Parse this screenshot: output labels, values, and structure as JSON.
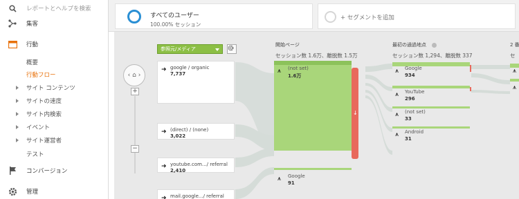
{
  "sidebar": {
    "search_placeholder": "レポートとヘルプを検索",
    "acquisition": "集客",
    "behavior": "行動",
    "behavior_items": [
      "概要",
      "行動フロー"
    ],
    "behavior_subitems": [
      "サイト コンテンツ",
      "サイトの速度",
      "サイト内検索",
      "イベント",
      "サイト運営者"
    ],
    "test": "テスト",
    "conversion": "コンバージョン",
    "admin": "管理",
    "accent": "#e8710a"
  },
  "segments": {
    "all_users": "すべてのユーザー",
    "all_users_sub": "100.00% セッション",
    "add_segment": "+ セグメントを追加"
  },
  "flow": {
    "dimension_dropdown": "参照元/メディア",
    "columns": [
      {
        "title": "開始ページ",
        "sub": "セッション数 1.6万、離脱数 1.5万"
      },
      {
        "title": "最初の通過地点",
        "sub": "セッション数 1,294、離脱数 337"
      },
      {
        "title": "2 番",
        "sub": "セ"
      }
    ],
    "sources": [
      {
        "name": "google / organic",
        "value": "7,737"
      },
      {
        "name": "(direct) / (none)",
        "value": "3,022"
      },
      {
        "name": "youtube.com.../ referral",
        "value": "2,410"
      },
      {
        "name": "mail.google.../ referral",
        "value": ""
      }
    ],
    "start_nodes": [
      {
        "name": "(not set)",
        "value": "1.6万"
      },
      {
        "name": "Google",
        "value": "91"
      }
    ],
    "first_interaction_nodes": [
      {
        "name": "Google",
        "value": "934"
      },
      {
        "name": "YouTube",
        "value": "296"
      },
      {
        "name": "(not set)",
        "value": "33"
      },
      {
        "name": "Android",
        "value": "31"
      }
    ],
    "zoom_in": "+",
    "zoom_out": "−",
    "node_color": "#a9d67a",
    "dropoff_color": "#e8695c"
  }
}
